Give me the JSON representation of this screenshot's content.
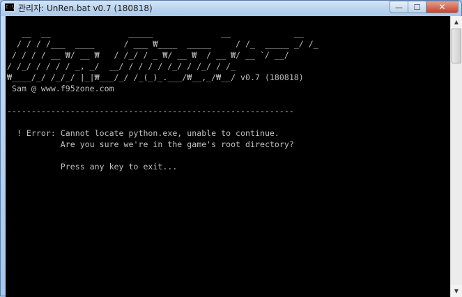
{
  "window": {
    "title": "관리자:  UnRen.bat v0.7 (180818)",
    "icon_text": "C:\\."
  },
  "caption_buttons": {
    "minimize_glyph": "—",
    "maximize_glyph": "☐",
    "close_glyph": "✕"
  },
  "console": {
    "lines": [
      "",
      "   __  __                _____              __             __",
      "  / / / /___  ____      / ___ ₩____  _____     / /_  _____ _/ /_",
      " / / / / __ ₩/ __ ₩   / /_/ / _ ₩/ __ ₩  / __ ₩/ __ `/ __/",
      "/ /_/ / / / / _, _/  __/ / / / / /_/ / /_/ / /_",
      "₩____/_/ /_/_/ |_|₩___/_/ /_(_)_.___/₩__,_/₩__/ v0.7 (180818)",
      " Sam @ www.f95zone.com",
      "",
      "-----------------------------------------------------------",
      "",
      "  ! Error: Cannot locate python.exe, unable to continue.",
      "           Are you sure we're in the game's root directory?",
      "",
      "           Press any key to exit..."
    ]
  },
  "scrollbar": {
    "up_glyph": "▲",
    "down_glyph": "▼"
  }
}
